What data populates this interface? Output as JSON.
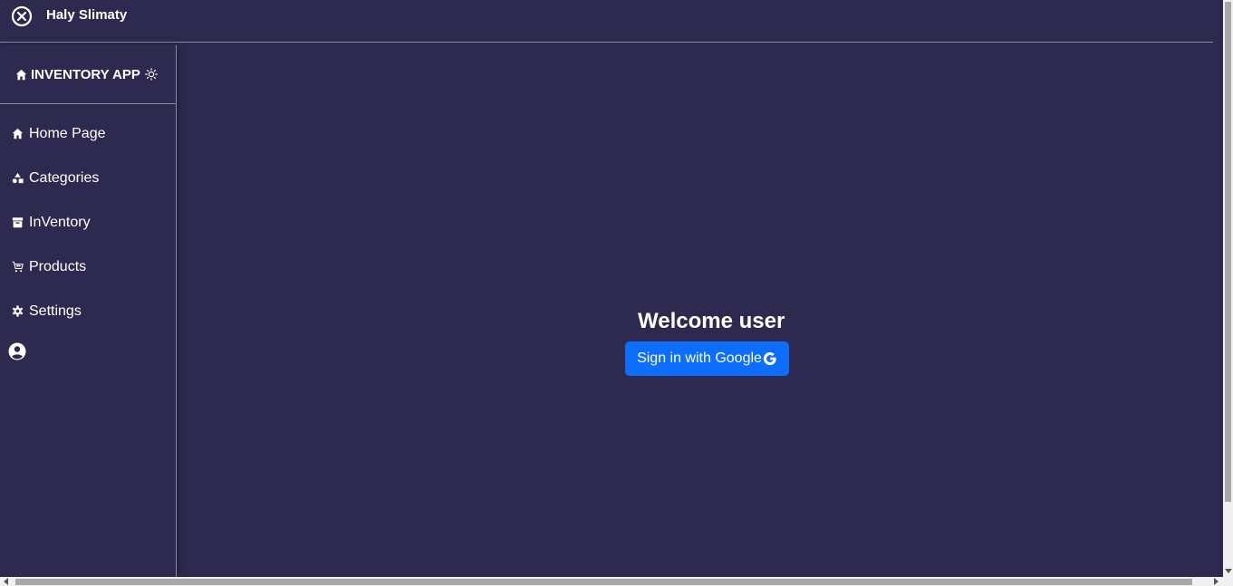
{
  "header": {
    "title": "Haly Slimaty",
    "close_icon": "close-circle-icon"
  },
  "sidebar": {
    "brand": "INVENTORY APP",
    "brand_icon": "home-icon",
    "theme_icon": "sun-icon",
    "items": [
      {
        "label": "Home Page",
        "icon": "home-icon"
      },
      {
        "label": "Categories",
        "icon": "shapes-icon"
      },
      {
        "label": "InVentory",
        "icon": "archive-icon"
      },
      {
        "label": "Products",
        "icon": "cart-icon"
      },
      {
        "label": "Settings",
        "icon": "gear-icon"
      }
    ],
    "account_icon": "user-circle-icon"
  },
  "main": {
    "welcome": "Welcome user",
    "signin_label": "Sign in with Google",
    "signin_icon": "google-icon",
    "signin_color": "#0d6efd"
  },
  "colors": {
    "background": "#2e2a4f",
    "border": "#8a88a0",
    "text": "#ffffff"
  }
}
